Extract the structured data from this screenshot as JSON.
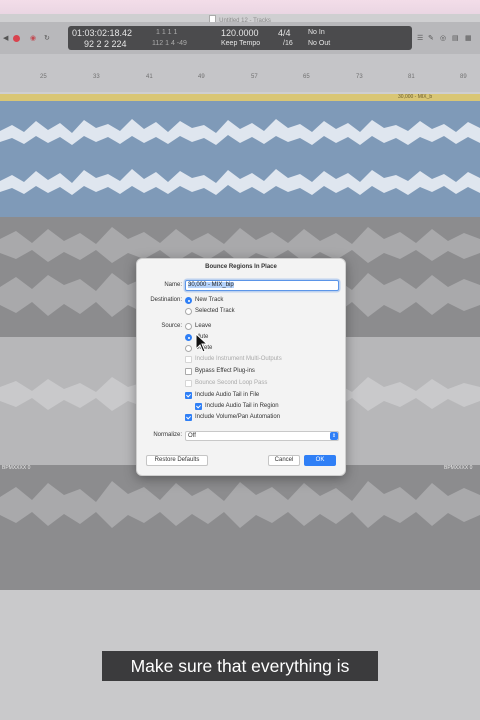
{
  "window": {
    "title": "Untitled 12 - Tracks"
  },
  "lcd": {
    "position_time": "01:03:02:18.42",
    "position_bars": "92  2  2  224",
    "locator_top": "1   1   1    1",
    "locator_bottom": "112  1  4  -49",
    "tempo": "120.0000",
    "tempo_mode": "Keep Tempo",
    "time_sig": "4/4",
    "division": "/16",
    "midi_in": "No In",
    "midi_out": "No Out"
  },
  "ruler": {
    "marks": [
      "25",
      "33",
      "41",
      "49",
      "57",
      "65",
      "73",
      "81",
      "89"
    ]
  },
  "tracks": {
    "cycle_label": "30,000 - MIX_b",
    "lower_label_left": "BPMXXXX 0",
    "lower_label_right": "BPMXXXX 0"
  },
  "dialog": {
    "title": "Bounce Regions In Place",
    "name_label": "Name:",
    "name_value": "30,000 - MIX_bip",
    "destination_label": "Destination:",
    "dest_new_track": "New Track",
    "dest_selected_track": "Selected Track",
    "source_label": "Source:",
    "src_leave": "Leave",
    "src_mute": "Mute",
    "src_delete": "Delete",
    "include_instrument": "Include Instrument Multi-Outputs",
    "bypass_effect": "Bypass Effect Plug-ins",
    "bounce_loop": "Bounce Second Loop Pass",
    "include_tail_file": "Include Audio Tail in File",
    "include_tail_region": "Include Audio Tail in Region",
    "include_volume": "Include Volume/Pan Automation",
    "normalize_label": "Normalize:",
    "normalize_value": "Off",
    "restore_defaults": "Restore Defaults",
    "cancel": "Cancel",
    "ok": "OK"
  },
  "caption": {
    "text": "Make sure that everything is"
  },
  "colors": {
    "accent": "#2f7ff6",
    "record": "#d9434e",
    "blue_track": "#7f9ab8",
    "cycle": "#d9c675"
  }
}
